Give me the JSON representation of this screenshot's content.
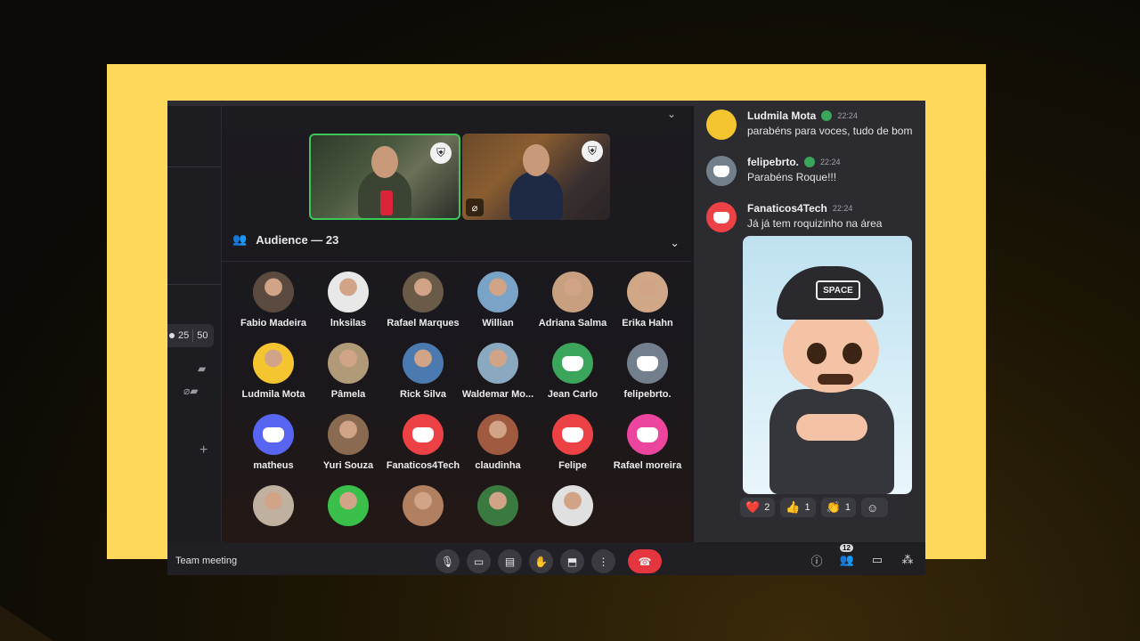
{
  "stage": {
    "audience_title": "Audience — 23"
  },
  "members": [
    {
      "name": "Fabio Madeira",
      "type": "photo",
      "color": "#5a4a40"
    },
    {
      "name": "lnksilas",
      "type": "photo",
      "color": "#e8e8e8"
    },
    {
      "name": "Rafael Marques",
      "type": "photo",
      "color": "#6a5a48"
    },
    {
      "name": "Willian",
      "type": "photo",
      "color": "#7aa3c8"
    },
    {
      "name": "Adriana Salma",
      "type": "photo",
      "color": "#c8a080"
    },
    {
      "name": "Erika Hahn",
      "type": "photo",
      "color": "#d0a888"
    },
    {
      "name": "Ludmila Mota",
      "type": "photo",
      "color": "#f5c530"
    },
    {
      "name": "Pâmela",
      "type": "photo",
      "color": "#b09a78"
    },
    {
      "name": "Rick Silva",
      "type": "photo",
      "color": "#4a7ab0"
    },
    {
      "name": "Waldemar Mo...",
      "type": "photo",
      "color": "#8aa8c0"
    },
    {
      "name": "Jean Carlo",
      "type": "discord",
      "color": "#3ba55c"
    },
    {
      "name": "felipebrto.",
      "type": "discord",
      "color": "#747f8d"
    },
    {
      "name": "matheus",
      "type": "discord",
      "color": "#5865f2"
    },
    {
      "name": "Yuri Souza",
      "type": "photo",
      "color": "#8a6a50"
    },
    {
      "name": "Fanaticos4Tech",
      "type": "discord",
      "color": "#ed4245"
    },
    {
      "name": "claudinha",
      "type": "photo",
      "color": "#a05a40"
    },
    {
      "name": "Felipe",
      "type": "discord",
      "color": "#ed4245"
    },
    {
      "name": "Rafael moreira",
      "type": "discord",
      "color": "#eb459e"
    },
    {
      "name": "",
      "type": "photo",
      "color": "#c0b0a0"
    },
    {
      "name": "",
      "type": "photo",
      "color": "#3ac04a"
    },
    {
      "name": "",
      "type": "photo",
      "color": "#b08060"
    },
    {
      "name": "",
      "type": "photo",
      "color": "#3a7a40"
    },
    {
      "name": "",
      "type": "photo",
      "color": "#e0e0e0"
    }
  ],
  "chat": {
    "messages": [
      {
        "author": "Ludmila Mota",
        "time": "22:24",
        "text": "parabéns para voces, tudo de bom",
        "avatar_color": "#f5c530"
      },
      {
        "author": "felipebrto.",
        "time": "22:24",
        "text": "Parabéns Roque!!!",
        "avatar_color": "#747f8d"
      },
      {
        "author": "Fanaticos4Tech",
        "time": "22:24",
        "text": "Já já tem roquizinho na área",
        "avatar_color": "#ed4245"
      }
    ],
    "sticker_cap_text": "SPACE",
    "reactions": [
      {
        "emoji": "❤️",
        "count": "2"
      },
      {
        "emoji": "👍",
        "count": "1"
      },
      {
        "emoji": "👏",
        "count": "1"
      },
      {
        "emoji": "☺",
        "count": ""
      }
    ]
  },
  "rail": {
    "counter_left": "25",
    "counter_right": "50"
  },
  "bottom_bar": {
    "meeting_title": "Team meeting",
    "people_count": "12"
  },
  "colors": {
    "frame": "#fdd85a",
    "speaking_border": "#3ec85a",
    "end_call": "#e5353f"
  }
}
